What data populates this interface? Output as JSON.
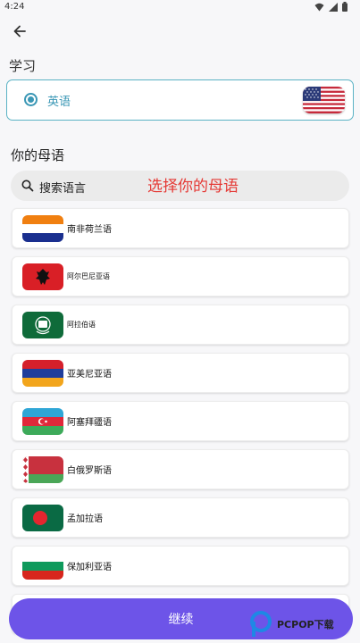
{
  "status_bar": {
    "time": "4:24"
  },
  "learn": {
    "label": "学习",
    "language": "英语",
    "flag_icon": "us-flag-icon"
  },
  "native": {
    "label": "你的母语"
  },
  "search": {
    "text": "搜索语言"
  },
  "caption": "选择你的母语",
  "languages": [
    {
      "name": "南非荷兰语",
      "flag": "south-africa-old-flag-icon"
    },
    {
      "name": "阿尔巴尼亚语",
      "flag": "albania-flag-icon"
    },
    {
      "name": "阿拉伯语",
      "flag": "arab-league-flag-icon"
    },
    {
      "name": "亚美尼亚语",
      "flag": "armenia-flag-icon"
    },
    {
      "name": "阿塞拜疆语",
      "flag": "azerbaijan-flag-icon"
    },
    {
      "name": "白俄罗斯语",
      "flag": "belarus-flag-icon"
    },
    {
      "name": "孟加拉语",
      "flag": "bangladesh-flag-icon"
    },
    {
      "name": "保加利亚语",
      "flag": "bulgaria-flag-icon"
    }
  ],
  "continue": {
    "label": "继续"
  },
  "watermark": {
    "text": "PCPOP下载"
  },
  "colors": {
    "accent": "#3a97b5",
    "button": "#6d54e8",
    "caption": "#e53935"
  }
}
